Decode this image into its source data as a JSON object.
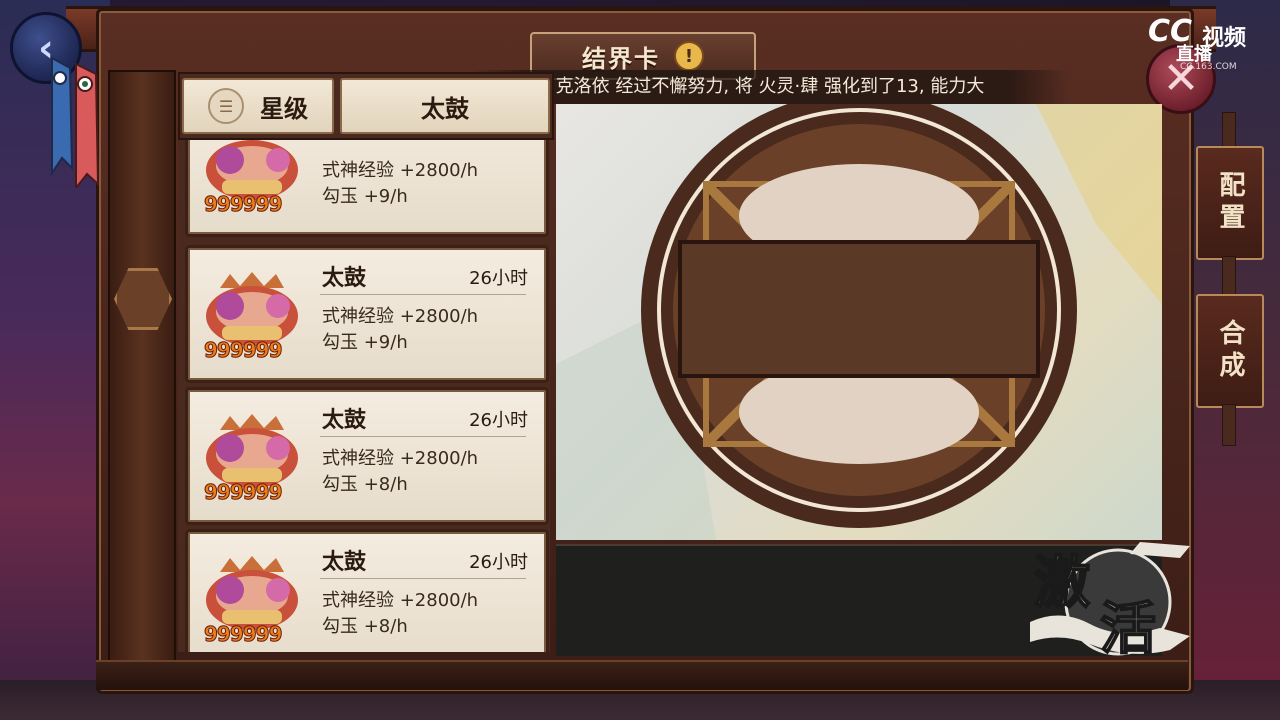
{
  "header": {
    "title": "结界卡",
    "info_icon": "exclamation-icon"
  },
  "marquee": {
    "text": "克洛依 经过不懈努力, 将 火灵·肆 强化到了13, 能力大"
  },
  "filters": {
    "star_label": "星级",
    "type_label": "太鼓"
  },
  "cards": [
    {
      "name": "",
      "time": "",
      "exp": "式神经验 +2800/h",
      "jade": "勾玉 +9/h",
      "count": "999999"
    },
    {
      "name": "太鼓",
      "time": "26小时",
      "exp": "式神经验 +2800/h",
      "jade": "勾玉 +9/h",
      "count": "999999"
    },
    {
      "name": "太鼓",
      "time": "26小时",
      "exp": "式神经验 +2800/h",
      "jade": "勾玉 +8/h",
      "count": "999999"
    },
    {
      "name": "太鼓",
      "time": "26小时",
      "exp": "式神经验 +2800/h",
      "jade": "勾玉 +8/h",
      "count": "999999"
    }
  ],
  "side_buttons": {
    "configure": "配置",
    "combine": "合成"
  },
  "activate_label": "激活",
  "close_glyph": "✕",
  "back_glyph": "‹",
  "watermark": {
    "brand": "CC",
    "video": "视频",
    "live": "直播",
    "url": "CC.163.COM"
  },
  "colors": {
    "frame": "#5a2e22",
    "card_bg": "#f4ece0",
    "accent_gold": "#e8b94a",
    "close_red": "#b04a5a"
  }
}
